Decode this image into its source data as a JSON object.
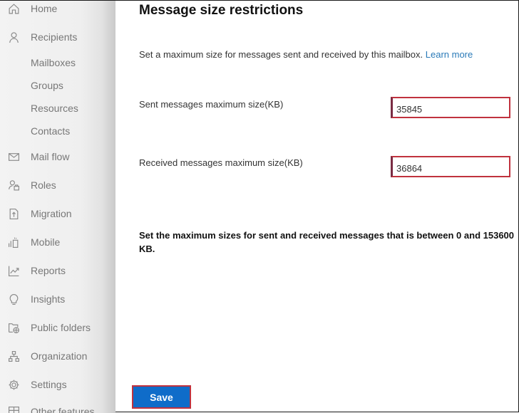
{
  "sidebar": {
    "items": [
      {
        "label": "Home",
        "icon": "home-icon"
      },
      {
        "label": "Recipients",
        "icon": "person-icon"
      },
      {
        "label": "Mailboxes",
        "icon": ""
      },
      {
        "label": "Groups",
        "icon": ""
      },
      {
        "label": "Resources",
        "icon": ""
      },
      {
        "label": "Contacts",
        "icon": ""
      },
      {
        "label": "Mail flow",
        "icon": "mail-icon"
      },
      {
        "label": "Roles",
        "icon": "roles-icon"
      },
      {
        "label": "Migration",
        "icon": "migration-icon"
      },
      {
        "label": "Mobile",
        "icon": "mobile-icon"
      },
      {
        "label": "Reports",
        "icon": "reports-icon"
      },
      {
        "label": "Insights",
        "icon": "lightbulb-icon"
      },
      {
        "label": "Public folders",
        "icon": "public-folder-icon"
      },
      {
        "label": "Organization",
        "icon": "organization-icon"
      },
      {
        "label": "Settings",
        "icon": "gear-icon"
      },
      {
        "label": "Other features",
        "icon": "grid-icon"
      }
    ]
  },
  "panel": {
    "title": "Message size restrictions",
    "description": "Set a maximum size for messages sent and received by this mailbox.",
    "learn_more": "Learn more",
    "sent_label": "Sent messages maximum size(KB)",
    "sent_value": "35845",
    "received_label": "Received messages maximum size(KB)",
    "received_value": "36864",
    "note": "Set the maximum sizes for sent and received messages that is between 0 and 153600 KB.",
    "save_label": "Save"
  },
  "colors": {
    "accent": "#0f6cc9",
    "highlight_border": "#c0323e",
    "link": "#2a7ab8"
  }
}
